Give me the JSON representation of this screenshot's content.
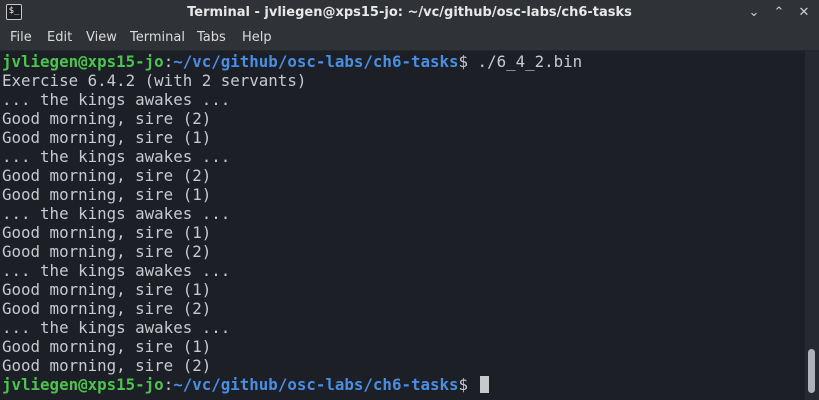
{
  "window": {
    "title": "Terminal - jvliegen@xps15-jo: ~/vc/github/osc-labs/ch6-tasks",
    "icon_glyph": "$_",
    "minimize_glyph": "⌄",
    "maximize_glyph": "⌃",
    "close_glyph": "✕"
  },
  "menubar": {
    "items": [
      "File",
      "Edit",
      "View",
      "Terminal",
      "Tabs",
      "Help"
    ]
  },
  "terminal": {
    "prompt": {
      "user_host": "jvliegen@xps15-jo",
      "colon": ":",
      "path": "~/vc/github/osc-labs/ch6-tasks",
      "dollar": "$"
    },
    "command": " ./6_4_2.bin",
    "output": [
      "Exercise 6.4.2 (with 2 servants)",
      "... the kings awakes ...",
      "Good morning, sire (2)",
      "Good morning, sire (1)",
      "... the kings awakes ...",
      "Good morning, sire (2)",
      "Good morning, sire (1)",
      "... the kings awakes ...",
      "Good morning, sire (1)",
      "Good morning, sire (2)",
      "... the kings awakes ...",
      "Good morning, sire (1)",
      "Good morning, sire (2)",
      "... the kings awakes ...",
      "Good morning, sire (1)",
      "Good morning, sire (2)"
    ]
  },
  "colors": {
    "prompt_user": "#4cc44e",
    "prompt_path": "#4a8ee3",
    "text": "#c7c9cc",
    "background": "#1c2026"
  }
}
